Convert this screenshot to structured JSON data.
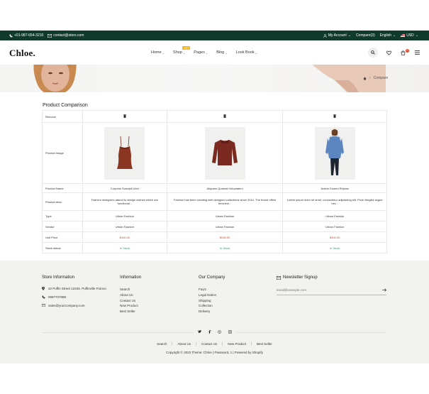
{
  "topbar": {
    "phone": "+01-987-654-3210",
    "email": "contact@store.com",
    "account": "My Account",
    "compare": "Compare(3)",
    "language": "English",
    "currency": "USD"
  },
  "header": {
    "logo": "Chloe.",
    "nav": [
      {
        "label": "Home"
      },
      {
        "label": "Shop",
        "badge": "HOT"
      },
      {
        "label": "Pages"
      },
      {
        "label": "Blog"
      },
      {
        "label": "Look Book"
      }
    ],
    "cart_count": "0"
  },
  "breadcrumb": {
    "current": "Compare"
  },
  "comparison": {
    "title": "Product Comparison",
    "labels": {
      "remove": "Remove",
      "image": "Product image",
      "name": "Product Name",
      "desc": "Product desc",
      "type": "Type",
      "vendor": "Vendor",
      "price": "Unit Price",
      "stock": "Stock status"
    },
    "products": [
      {
        "name": "Corporis Suscipit Liber",
        "desc": "Fashion designers attend to design clothes which are functional...",
        "type": "Urban Fashion",
        "vendor": "Urban Fashion",
        "price": "$100.00",
        "stock": "In Stock"
      },
      {
        "name": "Aliquam Quaerat Voluptatem",
        "desc": "Fashion has been creating well-designed collections since 2010. The brand offers feminine...",
        "type": "Urban Fashion",
        "vendor": "Urban Fashion",
        "price": "$200.00",
        "stock": "In Stock"
      },
      {
        "name": "Autem Eusem Reprae",
        "desc": "Lorem ipsum dolor sit amet, consectetur adipisicing elit. Proin fringilla augue nec...",
        "type": "Urban Fashion",
        "vendor": "Urban Fashion",
        "price": "$150.00",
        "stock": "In Stock"
      }
    ]
  },
  "footer": {
    "store_info": {
      "title": "Store Information",
      "address": "42 Puffin Street 12345, Puffinville France.",
      "phone": "0987707088",
      "email": "sales@yourcompany.com"
    },
    "information": {
      "title": "Information",
      "links": [
        "Search",
        "About Us",
        "Contact Us",
        "New Product",
        "Best Seller"
      ]
    },
    "company": {
      "title": "Our Company",
      "links": [
        "Faq's",
        "Legal Notice",
        "Shipping",
        "Collection",
        "Delivery"
      ]
    },
    "newsletter": {
      "title": "Newsletter Signup",
      "placeholder": "email@example.com"
    },
    "bottom_links": [
      "Search",
      "About Us",
      "Contact Us",
      "New Product",
      "Best Seller"
    ],
    "copyright": "Copyright © 2022 Theme: Chloe | Password, 1 | Powered by Shopify"
  },
  "icons": {
    "phone": "phone-icon",
    "email": "envelope-icon",
    "account": "user-icon",
    "search": "search-icon",
    "wishlist": "heart-icon",
    "cart": "cart-icon",
    "menu": "hamburger-icon",
    "home": "home-icon",
    "trash": "trash-icon",
    "socials": [
      "twitter-icon",
      "facebook-icon",
      "pinterest-icon",
      "instagram-icon"
    ]
  },
  "colors": {
    "topbar": "#0f3a2c",
    "price": "#c2492a",
    "in_stock": "#2ea36a",
    "badge": "#f4b41a",
    "footer_bg": "#f2f2f0"
  }
}
